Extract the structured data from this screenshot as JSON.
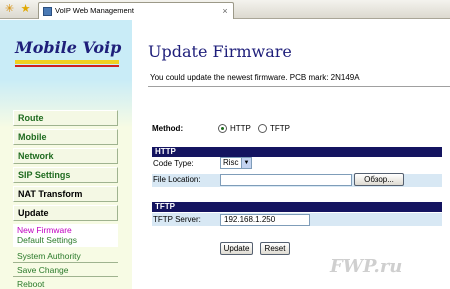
{
  "browser": {
    "tab_title": "VoIP Web Management",
    "icons": {
      "back": "home-icon",
      "favorites": "star-icon",
      "tab": "page-icon",
      "close": "close-icon"
    }
  },
  "sidebar": {
    "logo_text": "Mobile Voip",
    "menu": {
      "route": "Route",
      "mobile": "Mobile",
      "network": "Network",
      "sip_settings": "SIP Settings",
      "nat_transform": "NAT Transform",
      "update": "Update",
      "new_firmware": "New Firmware",
      "default_settings": "Default Settings",
      "system_authority": "System Authority",
      "save_change": "Save Change",
      "reboot": "Reboot"
    }
  },
  "main": {
    "title": "Update Firmware",
    "intro": "You could update the newest firmware. PCB mark: 2N149A",
    "method": {
      "label": "Method:",
      "options": [
        "HTTP",
        "TFTP"
      ],
      "selected": "HTTP"
    },
    "http": {
      "header": "HTTP",
      "code_type_label": "Code Type:",
      "code_type_value": "Risc",
      "file_location_label": "File Location:",
      "file_location_value": "",
      "browse_label": "Обзор..."
    },
    "tftp": {
      "header": "TFTP",
      "server_label": "TFTP Server:",
      "server_value": "192.168.1.250"
    },
    "buttons": {
      "update": "Update",
      "reset": "Reset"
    }
  },
  "watermark": "FWP.ru",
  "colors": {
    "navy": "#141460",
    "title": "#1e1e7a",
    "menu_text": "#1f6b1f",
    "active_submenu": "#c000c0"
  }
}
